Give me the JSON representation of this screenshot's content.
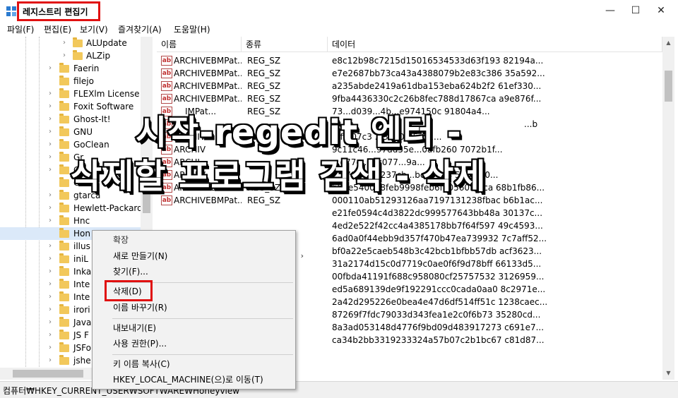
{
  "window": {
    "title": "레지스트리 편집기",
    "controls": {
      "minimize": "—",
      "maximize": "☐",
      "close": "✕"
    }
  },
  "menu": [
    "파일(F)",
    "편집(E)",
    "보기(V)",
    "즐겨찾기(A)",
    "도움말(H)"
  ],
  "tree": {
    "items": [
      {
        "label": "ALUpdate",
        "expander": "›"
      },
      {
        "label": "ALZip",
        "expander": "›"
      },
      {
        "label": "Faerin",
        "expander": "›"
      },
      {
        "label": "filejo",
        "expander": ""
      },
      {
        "label": "FLEXlm License M",
        "expander": "›"
      },
      {
        "label": "Foxit Software",
        "expander": "›"
      },
      {
        "label": "Ghost-It!",
        "expander": "›"
      },
      {
        "label": "GNU",
        "expander": "›"
      },
      {
        "label": "GoClean",
        "expander": "›"
      },
      {
        "label": "Gr",
        "expander": "›"
      },
      {
        "label": "G",
        "expander": "›"
      },
      {
        "label": "G",
        "expander": ""
      },
      {
        "label": "gtarca",
        "expander": "›"
      },
      {
        "label": "Hewlett-Packard",
        "expander": "›"
      },
      {
        "label": "Hnc",
        "expander": "›"
      },
      {
        "label": "Hon",
        "expander": ""
      },
      {
        "label": "illus",
        "expander": "›"
      },
      {
        "label": "iniL",
        "expander": "›"
      },
      {
        "label": "Inka",
        "expander": "›"
      },
      {
        "label": "Inte",
        "expander": "›"
      },
      {
        "label": "Inte",
        "expander": "›"
      },
      {
        "label": "irori",
        "expander": "›"
      },
      {
        "label": "Java",
        "expander": "›"
      },
      {
        "label": "JS F",
        "expander": "›"
      },
      {
        "label": "JSFo",
        "expander": "›"
      },
      {
        "label": "jshe",
        "expander": "›"
      }
    ]
  },
  "list": {
    "headers": {
      "name": "이름",
      "type": "종류",
      "data": "데이터"
    },
    "icon_text": "ab",
    "rows": [
      {
        "name": "ARCHIVEBMPat...",
        "type": "REG_SZ",
        "data": "e8c12b98c7215d15016534533d63f193 82194a..."
      },
      {
        "name": "ARCHIVEBMPat...",
        "type": "REG_SZ",
        "data": "e7e2687bb73ca43a4388079b2e83c386 35a592..."
      },
      {
        "name": "ARCHIVEBMPat...",
        "type": "REG_SZ",
        "data": "a235abde2419a61dba153eba624b2f2 61ef330..."
      },
      {
        "name": "ARCHIVEBMPat...",
        "type": "REG_SZ",
        "data": "9fba4436330c2c26b8fec788d17867ca a9e876f..."
      },
      {
        "name": "IMPat...",
        "type": "REG_SZ",
        "data": "73...d039...4b...e974150c 91804a4..."
      },
      {
        "name": "",
        "type": "",
        "data": "...b"
      },
      {
        "name": "ARCHIV",
        "type": "",
        "data": "...ff307c3 ...3210f05c51..."
      },
      {
        "name": "ARCHIV",
        "type": "",
        "data": "9c11c46...97dd55e...0afb260 7072b1f..."
      },
      {
        "name": "ARCHI",
        "type": "",
        "data": "...d77e...a c077...9a..."
      },
      {
        "name": "ARCHIV",
        "type": "",
        "data": "...27904...b237cb...be694e4 50bf110..."
      },
      {
        "name": "ARCHIVEBMPat...",
        "type": "REG_SZ",
        "data": "bbde540018feb9998feb6f70560f0aca 68b1fb86..."
      },
      {
        "name": "ARCHIVEBMPat...",
        "type": "REG_SZ",
        "data": "000110ab51293126aa7197131238fbac b6b1ac..."
      },
      {
        "name": "",
        "type": "",
        "data": "e21fe0594c4d3822dc999577643bb48a 30137c..."
      },
      {
        "name": "",
        "type": "",
        "data": "4ed2e522f42cc4a4385178bb7f64f597 49c4593..."
      },
      {
        "name": "",
        "type": "",
        "data": "6ad0a0f44ebb9d357f470b47ea739932 7c7aff52..."
      },
      {
        "name": "",
        "type": "",
        "data": "bf0a22e5caeb548b3c42bcb1bfbb57db acf3623..."
      },
      {
        "name": "",
        "type": "",
        "data": "31a2174d15c0d7719c0ae0f6f9d78bff 66133d5..."
      },
      {
        "name": "",
        "type": "",
        "data": "00fbda41191f688c958080cf25757532 3126959..."
      },
      {
        "name": "",
        "type": "",
        "data": "ed5a689139de9f192291ccc0cada0aa0 8c2971e..."
      },
      {
        "name": "",
        "type": "",
        "data": "2a42d295226e0bea4e47d6df514ff51c 1238caec..."
      },
      {
        "name": "",
        "type": "",
        "data": "87269f7fdc79033d343fea1e2c0f6b73 35280cd..."
      },
      {
        "name": "",
        "type": "",
        "data": "8a3ad053148d4776f9bd09d483917273 c691e7..."
      },
      {
        "name": "",
        "type": "",
        "data": "ca34b2bb3319233324a57b07c2b1bc67 c81d87..."
      }
    ]
  },
  "context_menu": {
    "expand": "확장",
    "new": "새로 만들기(N)",
    "find": "찾기(F)...",
    "delete": "삭제(D)",
    "rename": "이름 바꾸기(R)",
    "export": "내보내기(E)",
    "permissions": "사용 권한(P)...",
    "copy_key": "키 이름 복사(C)",
    "goto": "HKEY_LOCAL_MACHINE(으)로 이동(T)"
  },
  "status": {
    "path": "컴퓨터₩HKEY_CURRENT_USER₩SOFTWARE₩Honeyview"
  },
  "overlay": {
    "line1": "시작-regedit 엔터 -",
    "line2": "삭제할 프로그램 검색 - 삭제"
  },
  "colors": {
    "highlight_box": "#e01010",
    "folder": "#f2c85b",
    "menu_bg": "#f2f2f2"
  }
}
